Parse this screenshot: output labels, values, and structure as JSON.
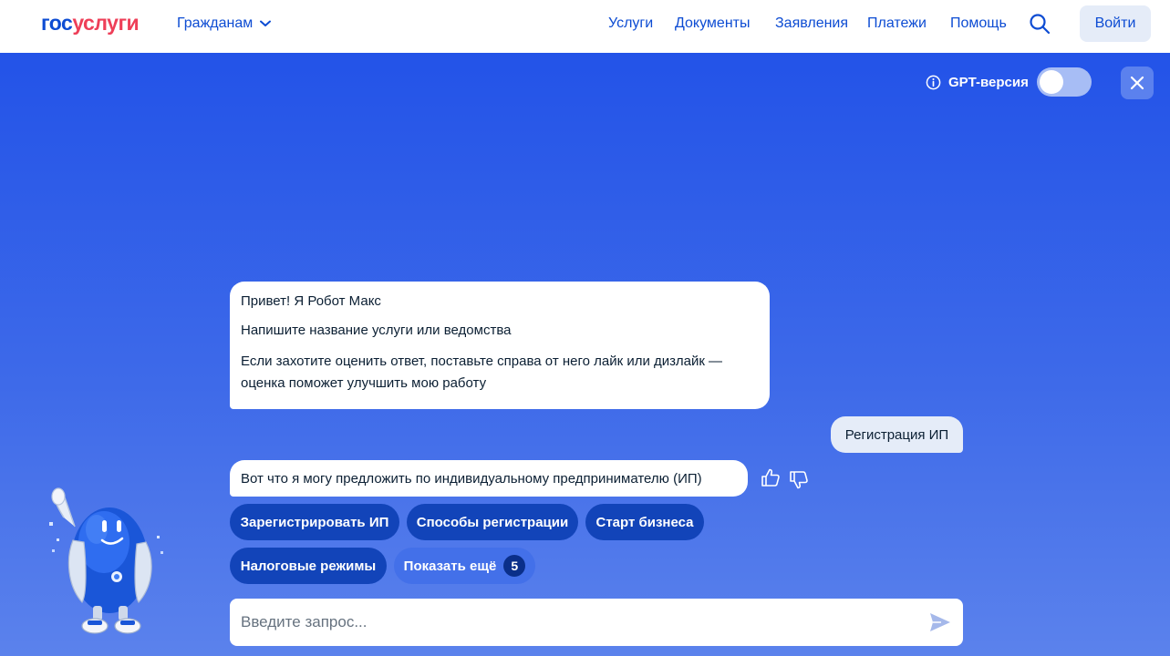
{
  "header": {
    "logo_part1": "гос",
    "logo_part2": "услуги",
    "citizens_label": "Гражданам",
    "nav": [
      "Услуги",
      "Документы",
      "Заявления",
      "Платежи",
      "Помощь"
    ],
    "login_label": "Войти"
  },
  "chat": {
    "gpt_label": "GPT-версия",
    "gpt_enabled": false,
    "bot_greeting": {
      "line1": "Привет! Я Робот Макс",
      "line2": "Напишите название услуги или ведомства",
      "line3": "Если захотите оценить ответ, поставьте справа от него лайк или дизлайк — оценка поможет улучшить мою работу"
    },
    "user_message": "Регистрация ИП",
    "bot_reply": "Вот что я могу предложить по индивидуальному предпринимателю (ИП)",
    "chips": [
      "Зарегистрировать ИП",
      "Способы регистрации",
      "Старт бизнеса",
      "Налоговые режимы"
    ],
    "show_more_label": "Показать ещё",
    "show_more_count": "5",
    "input_placeholder": "Введите запрос..."
  },
  "colors": {
    "brand_blue": "#0d4cd3",
    "brand_red": "#ee3f58",
    "chip_dark": "#1244b9",
    "background_top": "#2353e8"
  },
  "icons": [
    "chevron-down-icon",
    "search-icon",
    "info-icon",
    "close-icon",
    "thumbs-up-icon",
    "thumbs-down-icon",
    "send-icon",
    "robot-mascot"
  ]
}
